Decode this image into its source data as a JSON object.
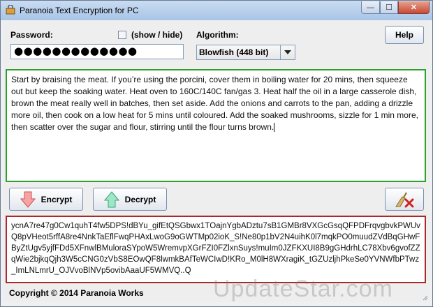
{
  "window": {
    "title": "Paranoia Text Encryption for PC",
    "minimize_glyph": "—",
    "maximize_glyph": "☐",
    "close_glyph": "✕"
  },
  "password": {
    "label": "Password:",
    "value": "●●●●●●●●●●●●●",
    "show_hide_label": "(show / hide)",
    "show_checked": false
  },
  "algorithm": {
    "label": "Algorithm:",
    "selected": "Blowfish (448 bit)"
  },
  "help_button": {
    "label": "Help"
  },
  "plaintext": "Start by braising the meat. If you’re using the porcini, cover them in boiling water for 20 mins, then squeeze out but keep the soaking water. Heat oven to 160C/140C fan/gas 3. Heat half the oil in a large casserole dish, brown the meat really well in batches, then set aside. Add the onions and carrots to the pan, adding a drizzle more oil, then cook on a low heat for 5 mins until coloured. Add the soaked mushrooms, sizzle for 1 min more, then scatter over the sugar and flour, stirring until the flour turns brown.",
  "encrypt_button": {
    "label": "Encrypt",
    "icon": "arrow-down-icon"
  },
  "decrypt_button": {
    "label": "Decrypt",
    "icon": "arrow-up-icon"
  },
  "clear_button": {
    "icon": "broom-clear-icon"
  },
  "ciphertext": "ycnA7re47g0Cw1quhT4fw5DPS!dBYu_gifEtQSGbwx1TOajnYgbADztu7sB1GMBr8VXGcGsqQFPDFrqvgbvkPWUvQ8pVHeot5rffA8re4NnkTaEflFwqPHAxLwoG9oGWTMp02ioK_S!Ne80p1bV2N4uihK0l7mqkPO0muudZVdBqGHwFByZtUgv5yjfFDd5XFnwlBMuloraSYpoW5WremvpXGrFZI0FZlxnSuys!muIm0JZFKXUI8B9gGHdrhLC78Xbv6gvofZZqWie2bjkqQjh3W5cCNG0zVbS8EOwQF8lwmkBAfTeWCIwD!KRo_M0lH8WXragiK_tGZUzljhPkeSe0YVNWfbPTwz_ImLNLmrU_OJVvoBlNVp5ovibAaaUF5WMVQ..Q",
  "footer": {
    "copyright": "Copyright © 2014 Paranoia Works"
  },
  "watermark": "UpdateStar.com",
  "colors": {
    "plaintext_border": "#2ea02e",
    "ciphertext_border": "#a82a2a",
    "encrypt_arrow": "#f08080",
    "decrypt_arrow": "#7fd9b0"
  }
}
